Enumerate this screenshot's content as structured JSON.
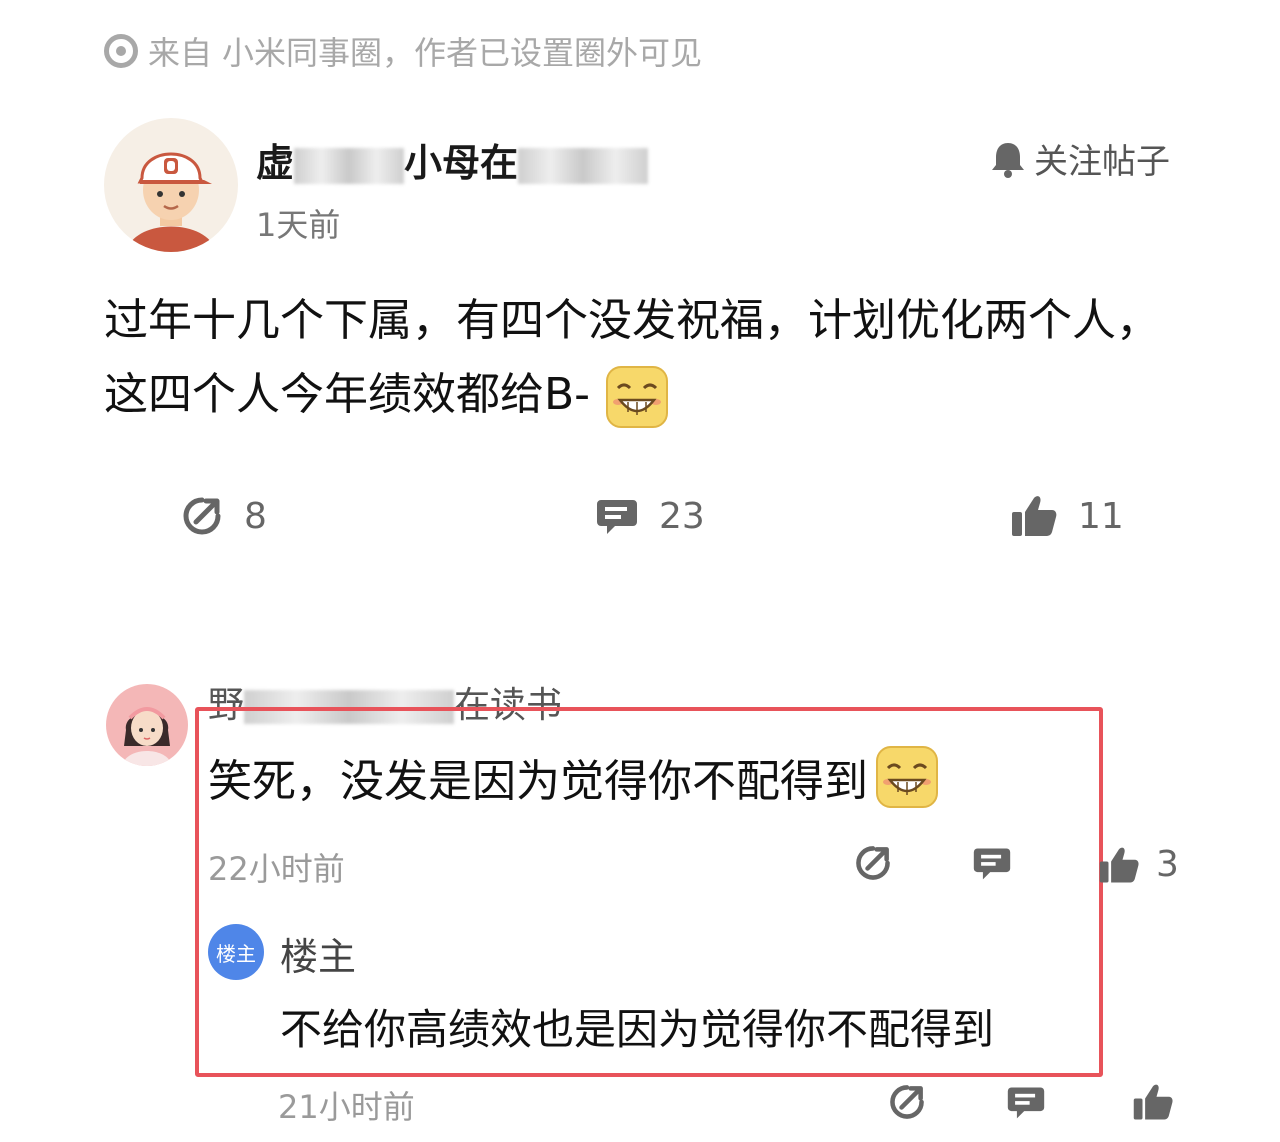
{
  "source": {
    "prefix": "来自",
    "circle": "小米同事圈，作者已设置圈外可见"
  },
  "post": {
    "author_visible_start": "虚",
    "author_visible_mid": "小母在",
    "time": "1天前",
    "follow_label": "关注帖子",
    "text": "过年十几个下属，有四个没发祝福，计划优化两个人，这四个人今年绩效都给B-",
    "actions": {
      "share_count": "8",
      "comment_count": "23",
      "like_count": "11"
    }
  },
  "comment": {
    "author_visible_start": "野",
    "author_visible_end": "在读书",
    "text": "笑死，没发是因为觉得你不配得到",
    "time": "22小时前",
    "like_count": "3"
  },
  "reply": {
    "badge": "楼主",
    "author": "楼主",
    "text": "不给你高绩效也是因为觉得你不配得到",
    "time": "21小时前"
  },
  "colors": {
    "highlight_border": "#e8535a",
    "badge_blue": "#4f86e8",
    "emoji_yellow": "#f7d86a"
  }
}
